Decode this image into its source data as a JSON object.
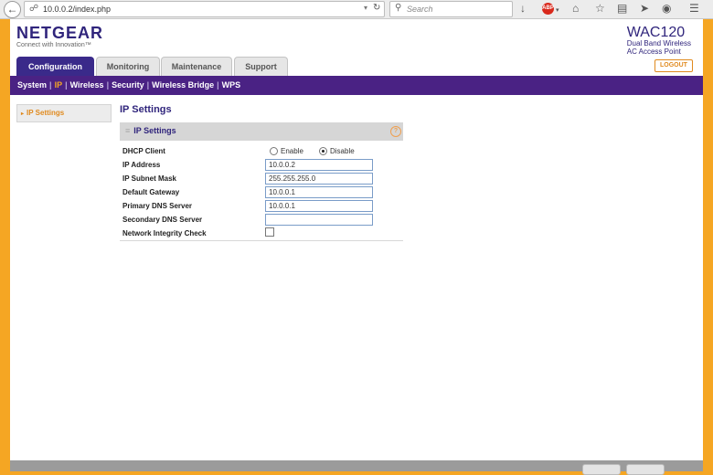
{
  "browser": {
    "url": "10.0.0.2/index.php",
    "search_placeholder": "Search",
    "adblock_label": "ABP"
  },
  "header": {
    "brand": "NETGEAR",
    "tagline": "Connect with Innovation™",
    "model": "WAC120",
    "desc_line1": "Dual Band Wireless",
    "desc_line2": "AC Access Point",
    "logout_label": "LOGOUT"
  },
  "tabs": [
    {
      "label": "Configuration",
      "active": true
    },
    {
      "label": "Monitoring",
      "active": false
    },
    {
      "label": "Maintenance",
      "active": false
    },
    {
      "label": "Support",
      "active": false
    }
  ],
  "subnav": [
    {
      "label": "System",
      "active": false
    },
    {
      "label": "IP",
      "active": true
    },
    {
      "label": "Wireless",
      "active": false
    },
    {
      "label": "Security",
      "active": false
    },
    {
      "label": "Wireless Bridge",
      "active": false
    },
    {
      "label": "WPS",
      "active": false
    }
  ],
  "sidebar": {
    "items": [
      {
        "label": "IP Settings",
        "active": true
      }
    ]
  },
  "content": {
    "title": "IP Settings",
    "section_title": "IP Settings",
    "help_icon_glyph": "?",
    "fields": {
      "dhcp_label": "DHCP Client",
      "dhcp_enable_label": "Enable",
      "dhcp_disable_label": "Disable",
      "dhcp_selected": "Disable",
      "ip_label": "IP Address",
      "ip_value": "10.0.0.2",
      "mask_label": "IP Subnet Mask",
      "mask_value": "255.255.255.0",
      "gateway_label": "Default Gateway",
      "gateway_value": "10.0.0.1",
      "dns1_label": "Primary DNS Server",
      "dns1_value": "10.0.0.1",
      "dns2_label": "Secondary DNS Server",
      "dns2_value": "",
      "integrity_label": "Network Integrity Check",
      "integrity_checked": false
    }
  },
  "colors": {
    "brand_purple": "#30257c",
    "nav_purple": "#4a2284",
    "accent_orange": "#f5a623"
  }
}
